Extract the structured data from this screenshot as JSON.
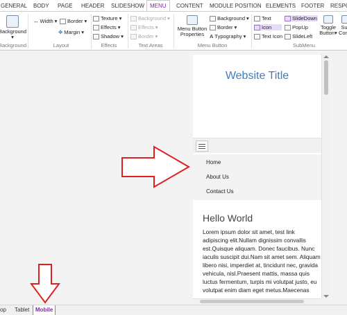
{
  "ribbon_tabs": [
    "GENERAL",
    "BODY",
    "PAGE",
    "HEADER",
    "SLIDESHOW",
    "MENU",
    "CONTENT",
    "MODULE POSITION",
    "ELEMENTS",
    "FOOTER",
    "RESPO"
  ],
  "active_tab": "MENU",
  "groups": {
    "background": {
      "big_label": "Background",
      "label": "Background"
    },
    "layout": {
      "label": "Layout",
      "width": "Width",
      "border": "Border",
      "margin": "Margin"
    },
    "effects": {
      "label": "Effects",
      "texture": "Texture",
      "effects": "Effects",
      "shadow": "Shadow"
    },
    "text_areas": {
      "label": "Text Areas",
      "background": "Background",
      "effects": "Effects",
      "border": "Border"
    },
    "menu_button": {
      "label": "Menu Button",
      "properties": "Menu Button Properties",
      "background": "Background",
      "border": "Border",
      "typography": "Typography"
    },
    "submenu": {
      "label": "SubMenu",
      "text": "Text",
      "icon": "Icon",
      "text_icon": "Text Icon",
      "slidedown": "SlideDown",
      "popup": "PopUp",
      "slideleft": "SlideLeft",
      "toggle_button": "Toggle Button",
      "sub_config": "Sub Config"
    }
  },
  "preview": {
    "title": "Website Title",
    "menu_items": [
      "Home",
      "About Us",
      "Contact Us"
    ],
    "heading": "Hello World",
    "body_text": " Lorem ipsum dolor sit amet, test link adipiscing elit.Nullam dignissim convallis est.Quisque aliquam. Donec faucibus. Nunc iaculis suscipit dui.Nam sit amet sem. Aliquam libero nisi, imperdiet at, tincidunt nec, gravida vehicula, nisl.Praesent mattis, massa quis luctus fermentum, turpis mi volutpat justo, eu volutpat enim diam eget metus.Maecenas"
  },
  "device_tabs": [
    "op",
    "Tablet",
    "Mobile"
  ],
  "active_device": "Mobile",
  "colors": {
    "accent": "#7b2b9c",
    "title_blue": "#3b7fc0",
    "arrow_red": "#e02020"
  }
}
